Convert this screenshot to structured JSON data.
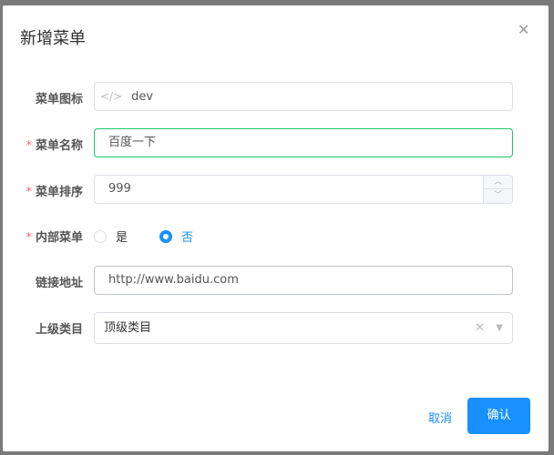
{
  "dialog": {
    "title": "新增菜单",
    "cancel": "取消",
    "confirm": "确认"
  },
  "form": {
    "icon": {
      "label": "菜单图标",
      "value": "dev",
      "icon": "code-icon"
    },
    "name": {
      "label": "菜单名称",
      "value": "百度一下",
      "required": true
    },
    "sort": {
      "label": "菜单排序",
      "value": "999",
      "required": true
    },
    "internal": {
      "label": "内部菜单",
      "required": true,
      "options": [
        "是",
        "否"
      ],
      "selected": "否"
    },
    "link": {
      "label": "链接地址",
      "value": "http://www.baidu.com"
    },
    "parent": {
      "label": "上级类目",
      "value": "顶级类目"
    }
  },
  "colors": {
    "primary": "#1890ff",
    "focus": "#1ec76a",
    "required": "#f56c6c"
  }
}
